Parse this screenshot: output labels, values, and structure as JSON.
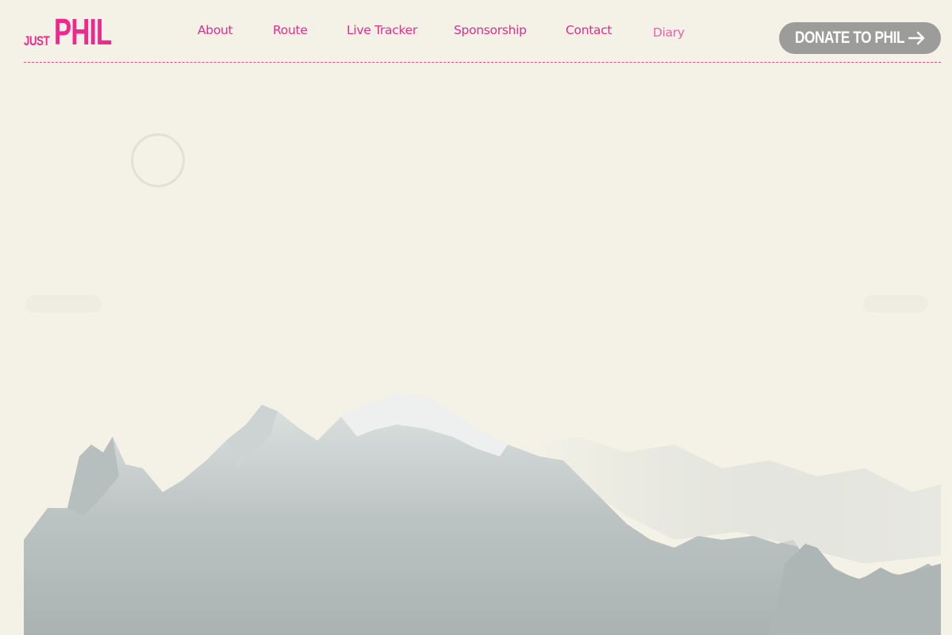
{
  "logo": {
    "just": "JUST",
    "phil": "PHIL"
  },
  "nav": {
    "items": [
      {
        "label": "About"
      },
      {
        "label": "Route"
      },
      {
        "label": "Live Tracker"
      },
      {
        "label": "Sponsorship"
      },
      {
        "label": "Contact"
      },
      {
        "label": "Diary"
      }
    ]
  },
  "donate": {
    "label": "DONATE TO PHIL",
    "icon": "arrow-right-icon"
  },
  "colors": {
    "brand_pink": "#f0288e",
    "background": "#f4f2e7",
    "button_gray": "#9c9c9a"
  }
}
